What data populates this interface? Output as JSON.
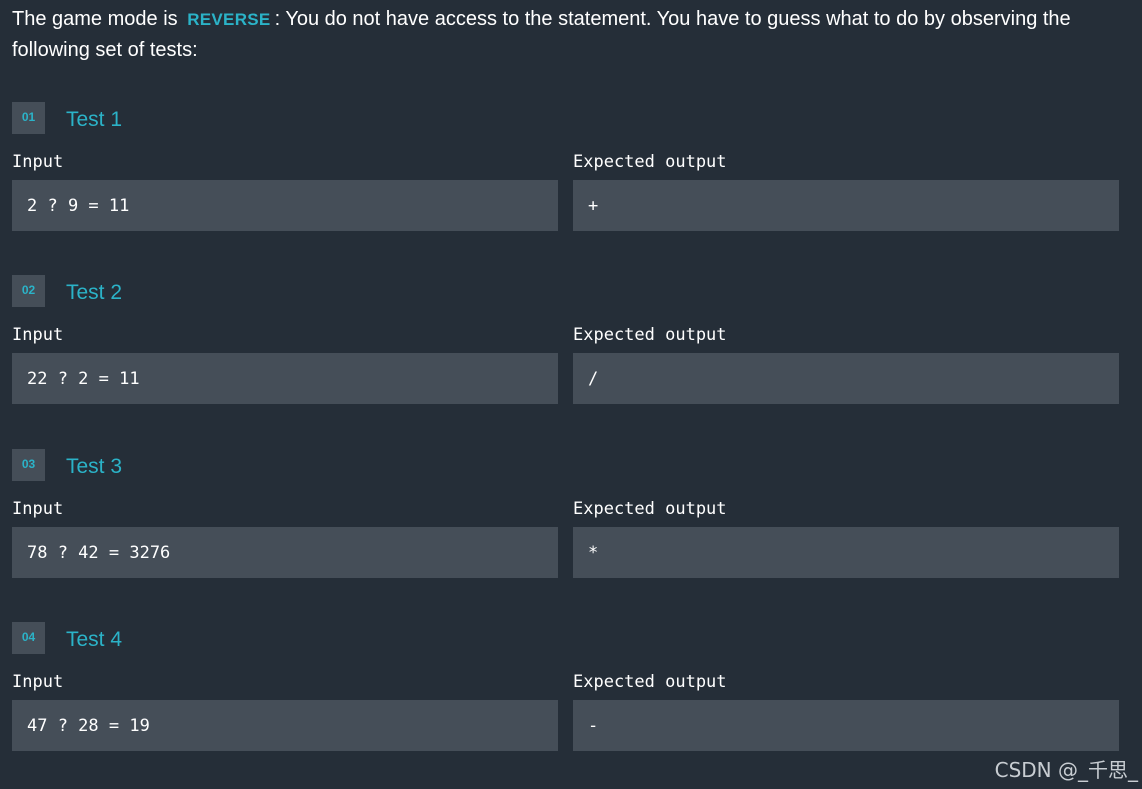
{
  "intro": {
    "prefix": "The game mode is",
    "mode": "REVERSE",
    "suffix": ": You do not have access to the statement. You have to guess what to do by observing the following set of tests:"
  },
  "labels": {
    "input": "Input",
    "expected": "Expected output"
  },
  "tests": [
    {
      "num": "01",
      "title": "Test 1",
      "input": "2 ? 9 = 11",
      "output": "+"
    },
    {
      "num": "02",
      "title": "Test 2",
      "input": "22 ? 2 = 11",
      "output": "/"
    },
    {
      "num": "03",
      "title": "Test 3",
      "input": "78 ? 42 = 3276",
      "output": "*"
    },
    {
      "num": "04",
      "title": "Test 4",
      "input": "47 ? 28 = 19",
      "output": "-"
    }
  ],
  "watermark": "CSDN @_千思_",
  "colors": {
    "background": "#252e38",
    "panel": "#454e58",
    "accent": "#2bb3c8",
    "text": "#ffffff"
  }
}
